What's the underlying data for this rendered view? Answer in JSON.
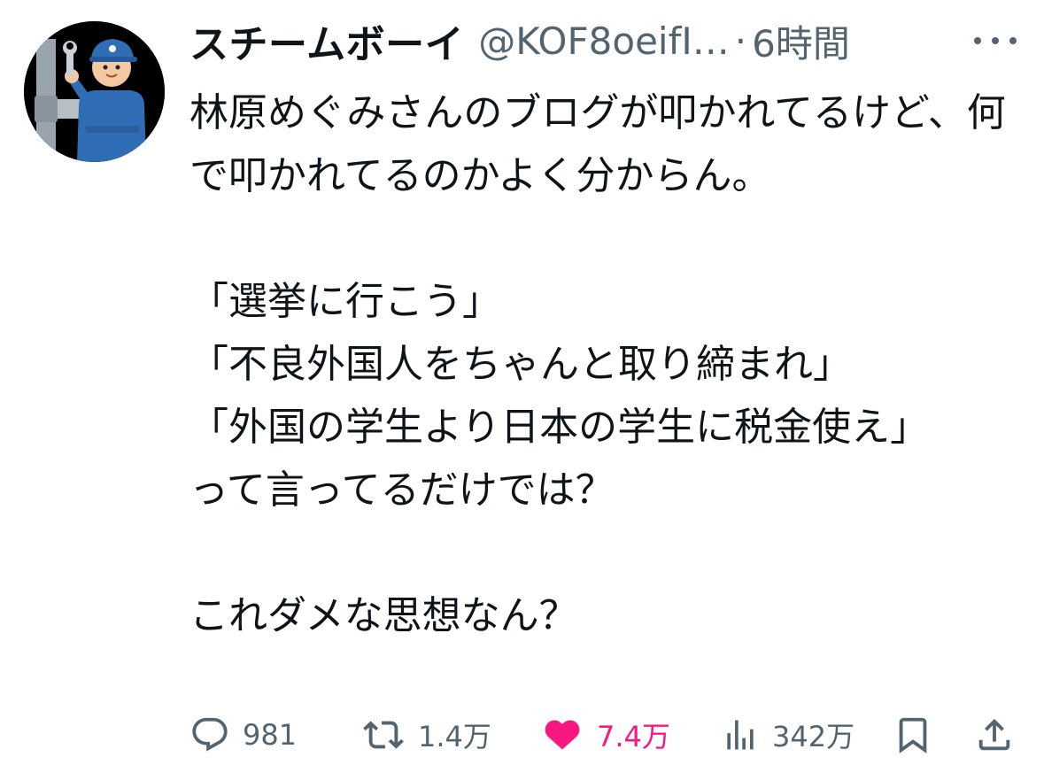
{
  "tweet": {
    "author_name": "スチームボーイ",
    "handle": "@KOF8oeifI…",
    "separator": "·",
    "timestamp": "6時間",
    "text": "林原めぐみさんのブログが叩かれてるけど、何で叩かれてるのかよく分からん。\n\n「選挙に行こう」\n「不良外国人をちゃんと取り締まれ」\n「外国の学生より日本の学生に税金使え」\nって言ってるだけでは？\n\nこれダメな思想なん？"
  },
  "actions": {
    "replies": "981",
    "retweets": "1.4万",
    "likes": "7.4万",
    "views": "342万"
  },
  "icons": {
    "more": "more-icon",
    "reply": "reply-icon",
    "retweet": "retweet-icon",
    "like": "heart-icon",
    "views": "views-icon",
    "bookmark": "bookmark-icon",
    "share": "share-icon"
  },
  "colors": {
    "text": "#0f1419",
    "secondary": "#536471",
    "like": "#f91880"
  }
}
